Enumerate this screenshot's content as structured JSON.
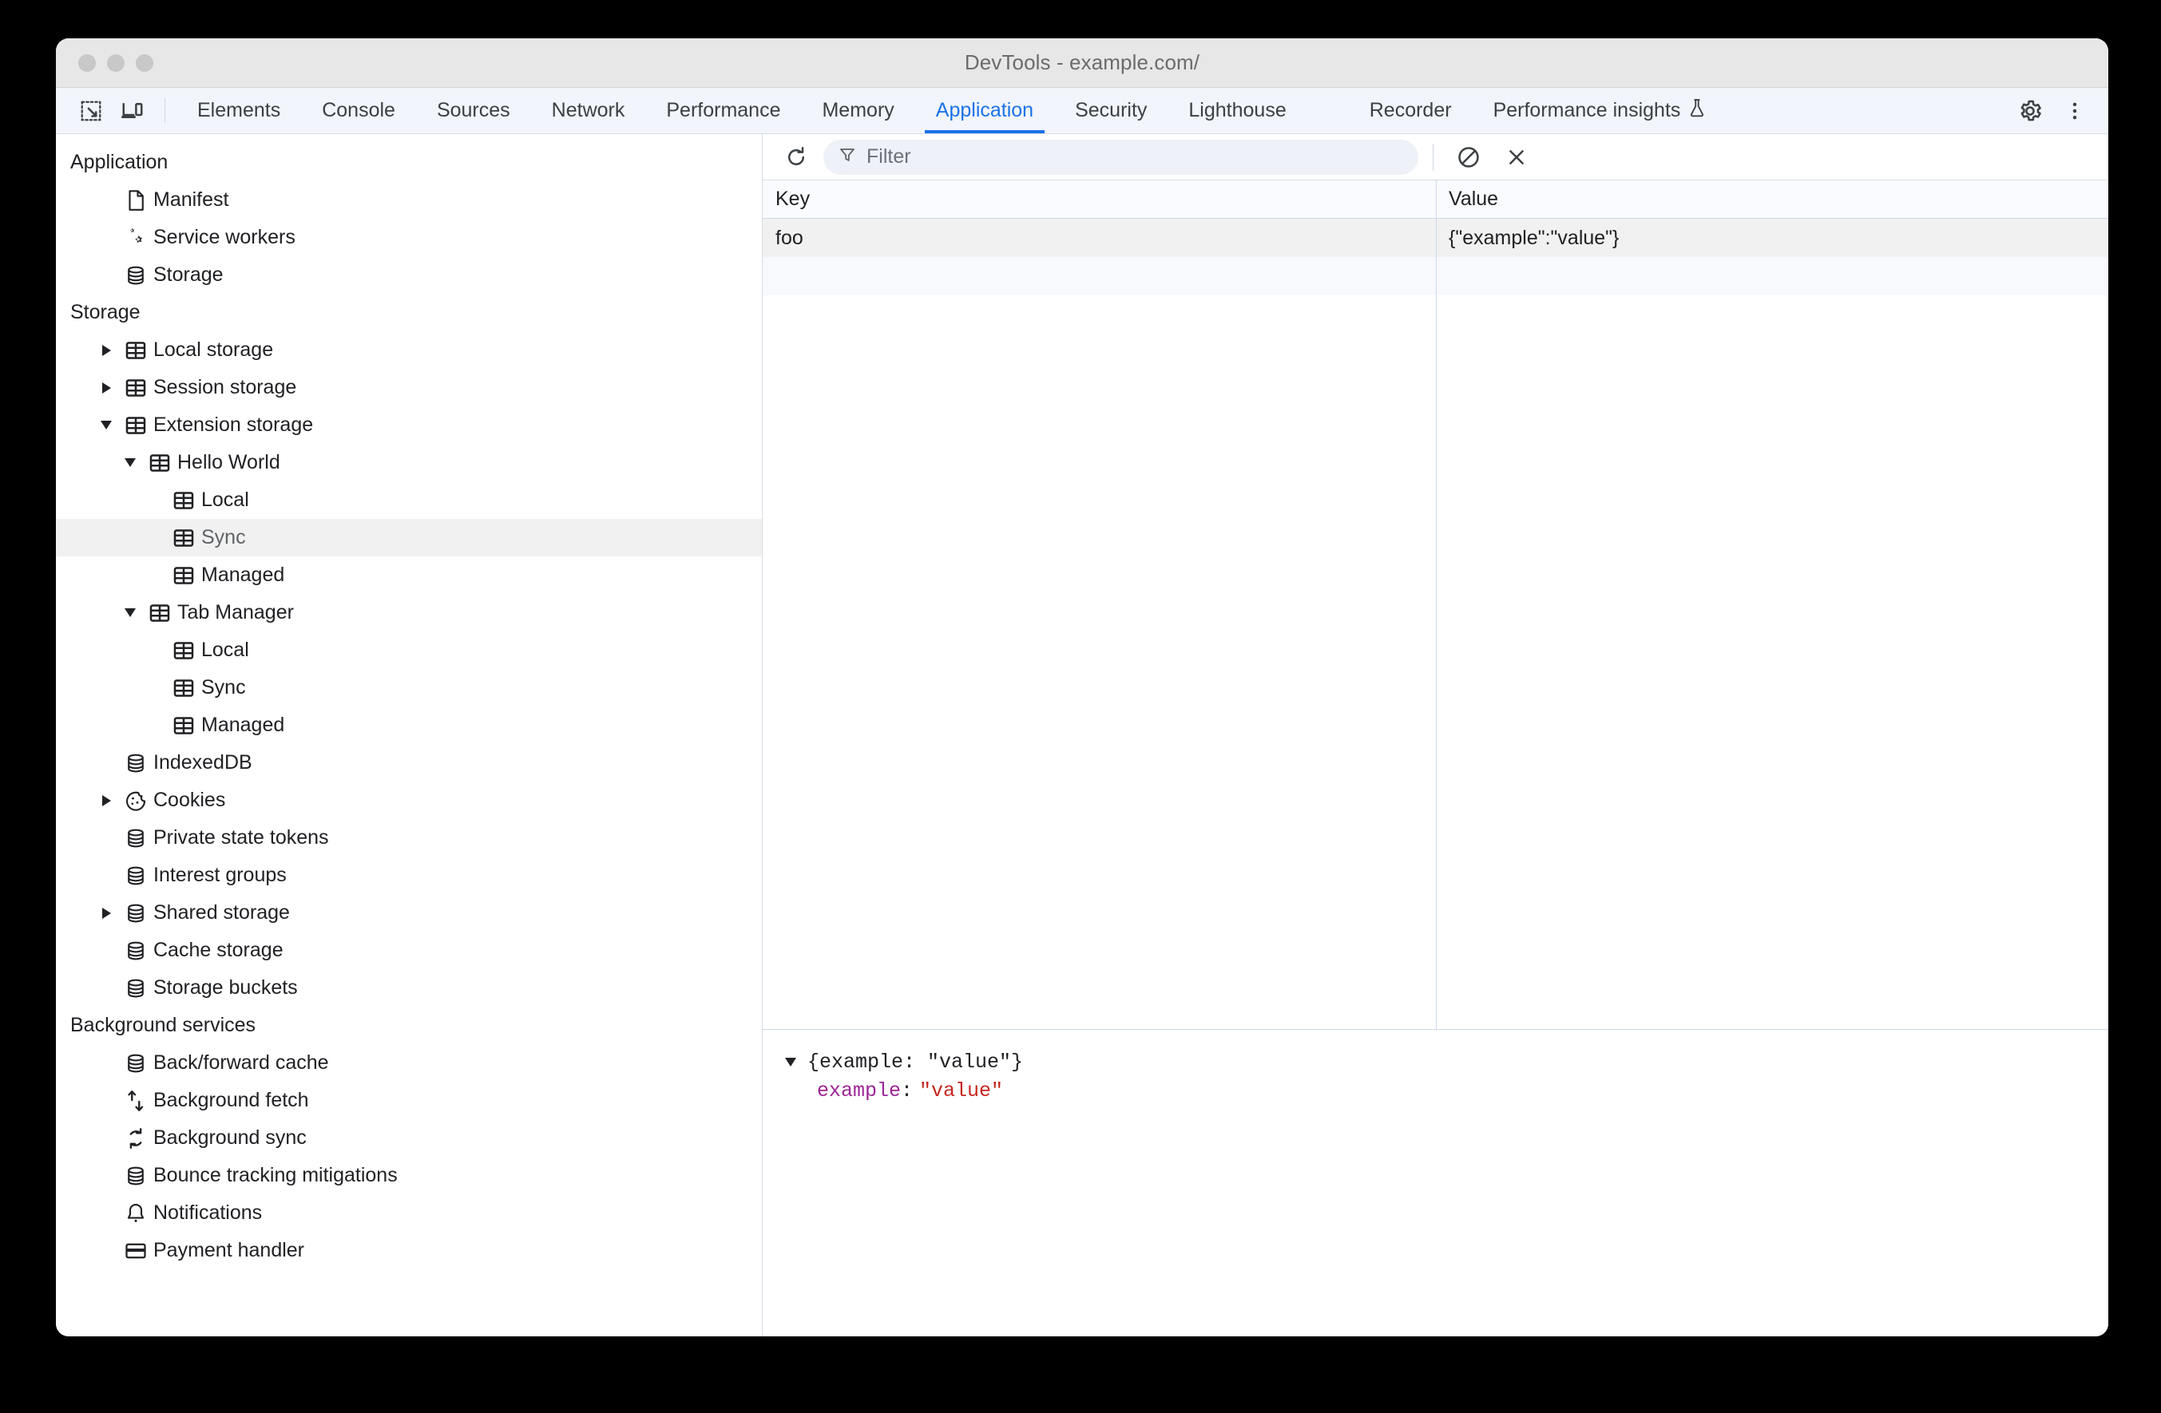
{
  "window": {
    "title": "DevTools - example.com/"
  },
  "tabbar": {
    "inspect_icon": "inspect-cursor-icon",
    "device_icon": "device-toolbar-icon",
    "tabs": [
      {
        "label": "Elements",
        "active": false
      },
      {
        "label": "Console",
        "active": false
      },
      {
        "label": "Sources",
        "active": false
      },
      {
        "label": "Network",
        "active": false
      },
      {
        "label": "Performance",
        "active": false
      },
      {
        "label": "Memory",
        "active": false
      },
      {
        "label": "Application",
        "active": true
      },
      {
        "label": "Security",
        "active": false
      },
      {
        "label": "Lighthouse",
        "active": false
      },
      {
        "label": "Recorder",
        "active": false
      },
      {
        "label": "Performance insights",
        "active": false,
        "badge_icon": "flask-icon"
      }
    ],
    "settings_icon": "gear-icon",
    "more_icon": "more-vertical-icon"
  },
  "sidebar": {
    "sections": [
      {
        "title": "Application",
        "items": [
          {
            "label": "Manifest",
            "icon": "document-icon",
            "indent": 1,
            "twisty": "none",
            "selected": false
          },
          {
            "label": "Service workers",
            "icon": "gears-icon",
            "indent": 1,
            "twisty": "none",
            "selected": false
          },
          {
            "label": "Storage",
            "icon": "database-icon",
            "indent": 1,
            "twisty": "none",
            "selected": false
          }
        ]
      },
      {
        "title": "Storage",
        "items": [
          {
            "label": "Local storage",
            "icon": "table-icon",
            "indent": 1,
            "twisty": "closed",
            "selected": false
          },
          {
            "label": "Session storage",
            "icon": "table-icon",
            "indent": 1,
            "twisty": "closed",
            "selected": false
          },
          {
            "label": "Extension storage",
            "icon": "table-icon",
            "indent": 1,
            "twisty": "open",
            "selected": false
          },
          {
            "label": "Hello World",
            "icon": "table-icon",
            "indent": 2,
            "twisty": "open",
            "selected": false
          },
          {
            "label": "Local",
            "icon": "table-icon",
            "indent": 3,
            "twisty": "none",
            "selected": false
          },
          {
            "label": "Sync",
            "icon": "table-icon",
            "indent": 3,
            "twisty": "none",
            "selected": true
          },
          {
            "label": "Managed",
            "icon": "table-icon",
            "indent": 3,
            "twisty": "none",
            "selected": false
          },
          {
            "label": "Tab Manager",
            "icon": "table-icon",
            "indent": 2,
            "twisty": "open",
            "selected": false
          },
          {
            "label": "Local",
            "icon": "table-icon",
            "indent": 3,
            "twisty": "none",
            "selected": false
          },
          {
            "label": "Sync",
            "icon": "table-icon",
            "indent": 3,
            "twisty": "none",
            "selected": false
          },
          {
            "label": "Managed",
            "icon": "table-icon",
            "indent": 3,
            "twisty": "none",
            "selected": false
          },
          {
            "label": "IndexedDB",
            "icon": "database-icon",
            "indent": 1,
            "twisty": "none",
            "selected": false
          },
          {
            "label": "Cookies",
            "icon": "cookie-icon",
            "indent": 1,
            "twisty": "closed",
            "selected": false
          },
          {
            "label": "Private state tokens",
            "icon": "database-icon",
            "indent": 1,
            "twisty": "none",
            "selected": false
          },
          {
            "label": "Interest groups",
            "icon": "database-icon",
            "indent": 1,
            "twisty": "none",
            "selected": false
          },
          {
            "label": "Shared storage",
            "icon": "database-icon",
            "indent": 1,
            "twisty": "closed",
            "selected": false
          },
          {
            "label": "Cache storage",
            "icon": "database-icon",
            "indent": 1,
            "twisty": "none",
            "selected": false
          },
          {
            "label": "Storage buckets",
            "icon": "database-icon",
            "indent": 1,
            "twisty": "none",
            "selected": false
          }
        ]
      },
      {
        "title": "Background services",
        "items": [
          {
            "label": "Back/forward cache",
            "icon": "database-icon",
            "indent": 1,
            "twisty": "none",
            "selected": false
          },
          {
            "label": "Background fetch",
            "icon": "updown-arrows-icon",
            "indent": 1,
            "twisty": "none",
            "selected": false
          },
          {
            "label": "Background sync",
            "icon": "sync-arrows-icon",
            "indent": 1,
            "twisty": "none",
            "selected": false
          },
          {
            "label": "Bounce tracking mitigations",
            "icon": "database-icon",
            "indent": 1,
            "twisty": "none",
            "selected": false
          },
          {
            "label": "Notifications",
            "icon": "bell-icon",
            "indent": 1,
            "twisty": "none",
            "selected": false
          },
          {
            "label": "Payment handler",
            "icon": "credit-card-icon",
            "indent": 1,
            "twisty": "none",
            "selected": false
          }
        ]
      }
    ]
  },
  "main": {
    "toolbar": {
      "refresh_icon": "refresh-icon",
      "filter_icon": "funnel-icon",
      "filter_value": "",
      "filter_placeholder": "Filter",
      "clear_all_icon": "clear-all-icon",
      "delete_selected_icon": "close-x-icon"
    },
    "table": {
      "columns": [
        "Key",
        "Value"
      ],
      "rows": [
        {
          "key": "foo",
          "value": "{\"example\":\"value\"}",
          "selected": true
        }
      ]
    },
    "preview": {
      "root_twisty": "open",
      "root_text": "{example: \"value\"}",
      "property": "example",
      "separator": ":",
      "value": "\"value\""
    }
  },
  "colors": {
    "accent": "#1a73e8",
    "selection": "#f1f1f1",
    "property": "#9c2596",
    "string": "#c5271f",
    "border": "#d7dce5"
  }
}
